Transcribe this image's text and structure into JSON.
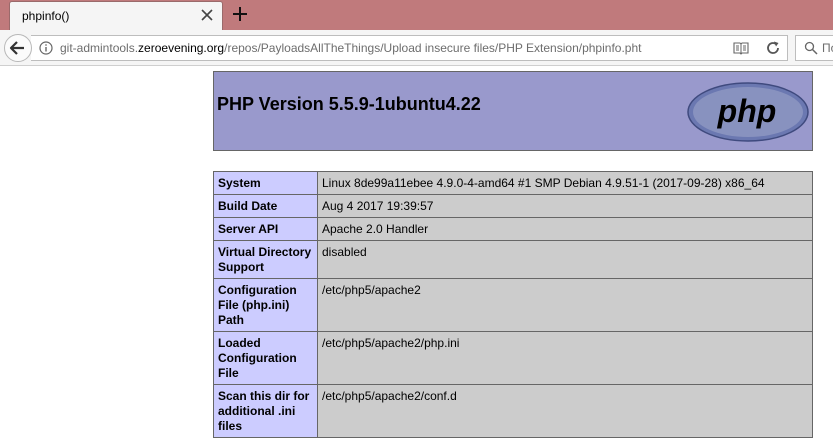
{
  "tab": {
    "title": "phpinfo()"
  },
  "nav": {
    "url_prefix": "git-admintools.",
    "url_host": "zeroevening.org",
    "url_path": "/repos/PayloadsAllTheThings/Upload insecure files/PHP Extension/phpinfo.pht",
    "search_placeholder": "Пои"
  },
  "page": {
    "title": "PHP Version 5.5.9-1ubuntu4.22",
    "logo_text": "php",
    "rows": [
      {
        "key": "System",
        "value": "Linux 8de99a11ebee 4.9.0-4-amd64 #1 SMP Debian 4.9.51-1 (2017-09-28) x86_64"
      },
      {
        "key": "Build Date",
        "value": "Aug 4 2017 19:39:57"
      },
      {
        "key": "Server API",
        "value": "Apache 2.0 Handler"
      },
      {
        "key": "Virtual Directory Support",
        "value": "disabled"
      },
      {
        "key": "Configuration File (php.ini) Path",
        "value": "/etc/php5/apache2"
      },
      {
        "key": "Loaded Configuration File",
        "value": "/etc/php5/apache2/php.ini"
      },
      {
        "key": "Scan this dir for additional .ini files",
        "value": "/etc/php5/apache2/conf.d"
      }
    ]
  },
  "colors": {
    "header_bg": "#9999cc",
    "key_bg": "#ccccff",
    "value_bg": "#cccccc",
    "tabstrip": "#c07a7c"
  }
}
